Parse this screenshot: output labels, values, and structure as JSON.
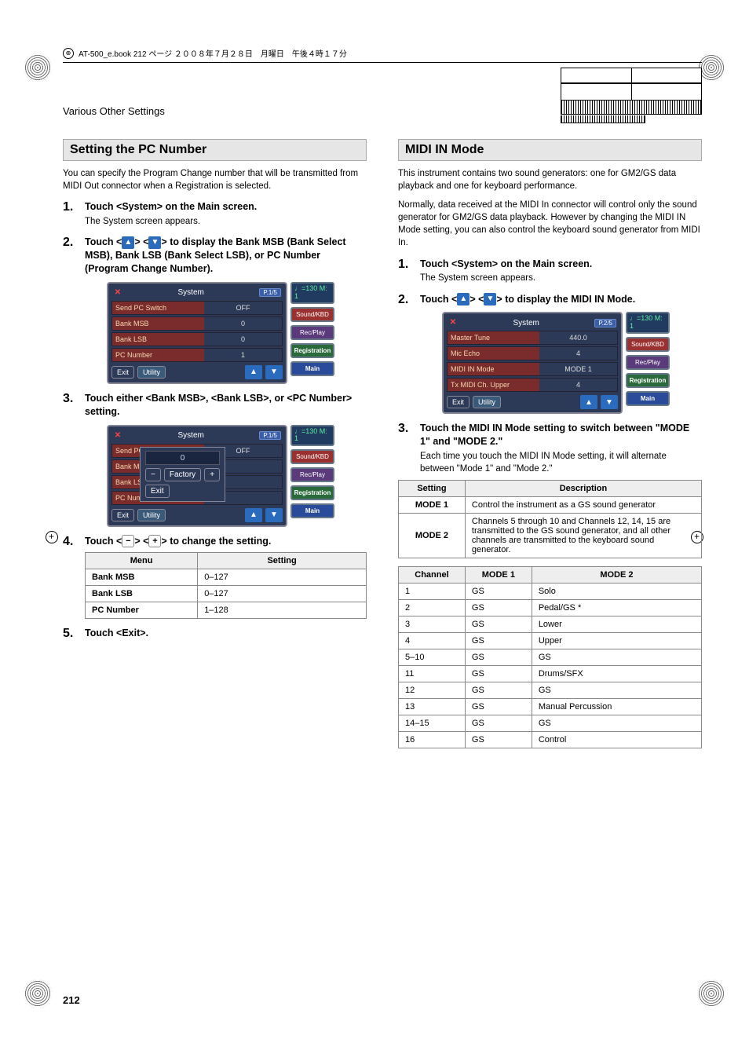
{
  "book_header": "AT-500_e.book  212 ページ  ２００８年７月２８日　月曜日　午後４時１７分",
  "section_header": "Various Other Settings",
  "page_number": "212",
  "left": {
    "heading": "Setting the PC Number",
    "intro": "You can specify the Program Change number that will be transmitted from MIDI Out connector when a Registration is selected.",
    "step1_title": "Touch <System> on the Main screen.",
    "step1_body": "The System screen appears.",
    "step2_title_a": "Touch <",
    "step2_title_b": "> <",
    "step2_title_c": "> to display the Bank MSB (Bank Select MSB), Bank LSB (Bank Select LSB), or PC Number (Program Change Number).",
    "step3_title": "Touch either <Bank MSB>, <Bank LSB>, or <PC Number> setting.",
    "step4_title_a": "Touch <",
    "step4_title_b": "> <",
    "step4_title_c": "> to change the setting.",
    "step5_title": "Touch <Exit>.",
    "minus_label": "−",
    "plus_label": "+",
    "screenshot1": {
      "title": "System",
      "page_badge": "P.1/5",
      "tempo": "♩=130\nM:    1",
      "rows": [
        {
          "label": "Send PC Switch",
          "value": "OFF"
        },
        {
          "label": "Bank MSB",
          "value": "0"
        },
        {
          "label": "Bank LSB",
          "value": "0"
        },
        {
          "label": "PC Number",
          "value": "1"
        }
      ],
      "exit": "Exit",
      "utility": "Utility",
      "side": [
        "Sound/KBD",
        "Rec/Play",
        "Registration",
        "Main"
      ]
    },
    "screenshot2": {
      "title": "System",
      "page_badge": "P.1/5",
      "tempo": "♩=130\nM:    1",
      "rows": [
        {
          "label": "Send PC Switch",
          "value": "OFF"
        },
        {
          "label": "Bank MS",
          "value": ""
        },
        {
          "label": "Bank LS",
          "value": ""
        },
        {
          "label": "PC Numb",
          "value": ""
        }
      ],
      "popup_value": "0",
      "popup_minus": "−",
      "popup_plus": "+",
      "popup_factory": "Factory",
      "popup_exit": "Exit",
      "exit": "Exit",
      "utility": "Utility",
      "side": [
        "Sound/KBD",
        "Rec/Play",
        "Registration",
        "Main"
      ]
    },
    "menu_table": {
      "headers": [
        "Menu",
        "Setting"
      ],
      "rows": [
        [
          "Bank MSB",
          "0–127"
        ],
        [
          "Bank LSB",
          "0–127"
        ],
        [
          "PC Number",
          "1–128"
        ]
      ]
    }
  },
  "right": {
    "heading": "MIDI IN Mode",
    "intro1": "This instrument contains two sound generators: one for GM2/GS data playback and one for keyboard performance.",
    "intro2": "Normally, data received at the MIDI In connector will control only the sound generator for GM2/GS data playback. However by changing the MIDI IN Mode setting, you can also control the keyboard sound generator from MIDI In.",
    "step1_title": "Touch <System> on the Main screen.",
    "step1_body": "The System screen appears.",
    "step2_title_a": "Touch <",
    "step2_title_b": "> <",
    "step2_title_c": "> to display the MIDI IN Mode.",
    "step3_title": "Touch the MIDI IN Mode setting to switch between \"MODE 1\" and \"MODE 2.\"",
    "step3_body": "Each time you touch the MIDI IN Mode setting, it will alternate between \"Mode 1\" and \"Mode 2.\"",
    "screenshot": {
      "title": "System",
      "page_badge": "P.2/5",
      "tempo": "♩=130\nM:    1",
      "rows": [
        {
          "label": "Master Tune",
          "value": "440.0"
        },
        {
          "label": "Mic Echo",
          "value": "4"
        },
        {
          "label": "MIDI IN Mode",
          "value": "MODE 1"
        },
        {
          "label": "Tx MIDI Ch. Upper",
          "value": "4"
        }
      ],
      "exit": "Exit",
      "utility": "Utility",
      "side": [
        "Sound/KBD",
        "Rec/Play",
        "Registration",
        "Main"
      ]
    },
    "setting_table": {
      "headers": [
        "Setting",
        "Description"
      ],
      "rows": [
        [
          "MODE 1",
          "Control the instrument as a GS sound generator"
        ],
        [
          "MODE 2",
          "Channels 5 through 10 and Channels 12, 14, 15 are transmitted to the GS sound generator, and all other channels are transmitted to the keyboard sound generator."
        ]
      ]
    },
    "channel_table": {
      "headers": [
        "Channel",
        "MODE 1",
        "MODE 2"
      ],
      "rows": [
        [
          "1",
          "GS",
          "Solo"
        ],
        [
          "2",
          "GS",
          "Pedal/GS *"
        ],
        [
          "3",
          "GS",
          "Lower"
        ],
        [
          "4",
          "GS",
          "Upper"
        ],
        [
          "5–10",
          "GS",
          "GS"
        ],
        [
          "11",
          "GS",
          "Drums/SFX"
        ],
        [
          "12",
          "GS",
          "GS"
        ],
        [
          "13",
          "GS",
          "Manual Percussion"
        ],
        [
          "14–15",
          "GS",
          "GS"
        ],
        [
          "16",
          "GS",
          "Control"
        ]
      ]
    }
  }
}
